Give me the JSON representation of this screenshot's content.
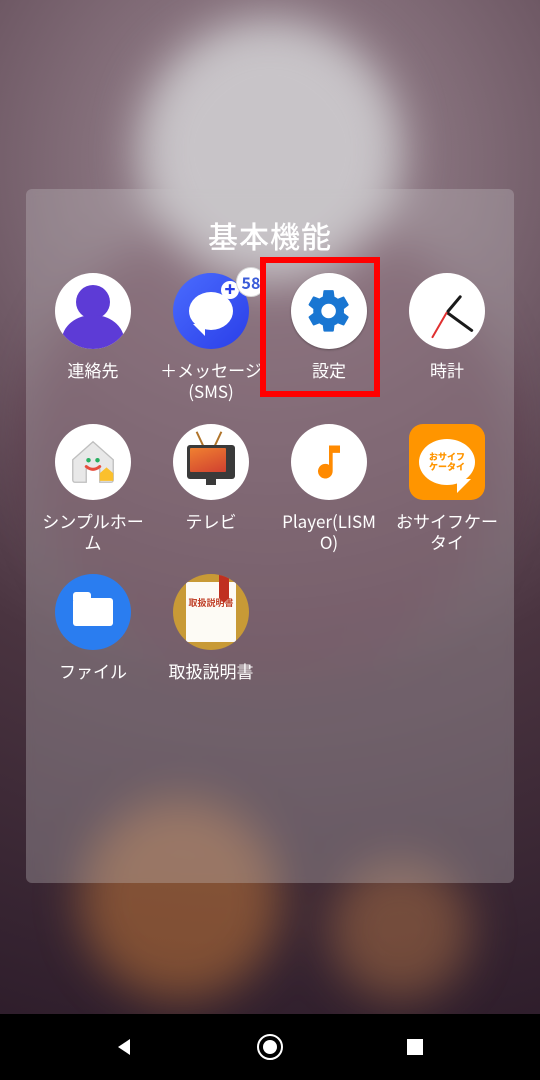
{
  "folder": {
    "title": "基本機能",
    "apps": [
      {
        "label": "連絡先",
        "icon": "contacts-icon",
        "badge": null,
        "highlighted": false
      },
      {
        "label": "＋メッセージ(SMS)",
        "icon": "plus-message-icon",
        "badge": "58",
        "highlighted": false
      },
      {
        "label": "設定",
        "icon": "settings-gear-icon",
        "badge": null,
        "highlighted": true
      },
      {
        "label": "時計",
        "icon": "clock-icon",
        "badge": null,
        "highlighted": false
      },
      {
        "label": "シンプルホーム",
        "icon": "simple-home-icon",
        "badge": null,
        "highlighted": false
      },
      {
        "label": "テレビ",
        "icon": "tv-icon",
        "badge": null,
        "highlighted": false
      },
      {
        "label": "Player(LISMO)",
        "icon": "music-player-icon",
        "badge": null,
        "highlighted": false
      },
      {
        "label": "おサイフケータイ",
        "icon": "osaifu-keitai-icon",
        "badge": null,
        "highlighted": false
      },
      {
        "label": "ファイル",
        "icon": "files-icon",
        "badge": null,
        "highlighted": false
      },
      {
        "label": "取扱説明書",
        "icon": "manual-icon",
        "badge": null,
        "highlighted": false
      }
    ]
  },
  "osaifu_text_line1": "おサイフ",
  "osaifu_text_line2": "ケータイ",
  "manual_text": "取扱説明書"
}
